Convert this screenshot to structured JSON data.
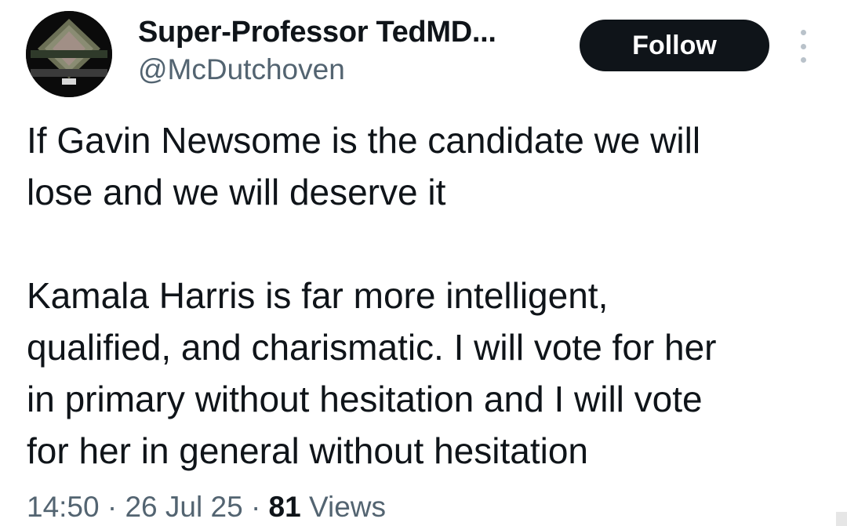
{
  "author": {
    "display_name": "Super-Professor TedMD...",
    "handle": "@McDutchoven",
    "avatar_icon": "avatar-image"
  },
  "actions": {
    "follow_label": "Follow",
    "more_icon": "more-vertical-icon"
  },
  "tweet": {
    "lines": [
      "If Gavin Newsome is the candidate we will",
      "lose and we will deserve it",
      "",
      "Kamala Harris is far more intelligent,",
      "qualified, and charismatic.  I will vote for her",
      "in primary without hesitation and I will vote",
      "for her in general without hesitation"
    ]
  },
  "meta": {
    "time": "14:50",
    "separator": "·",
    "date": "26 Jul 25",
    "views_count": "81",
    "views_label": "Views"
  },
  "colors": {
    "text_primary": "#0f1419",
    "text_secondary": "#536471",
    "button_bg": "#0f1419",
    "button_text": "#ffffff"
  }
}
